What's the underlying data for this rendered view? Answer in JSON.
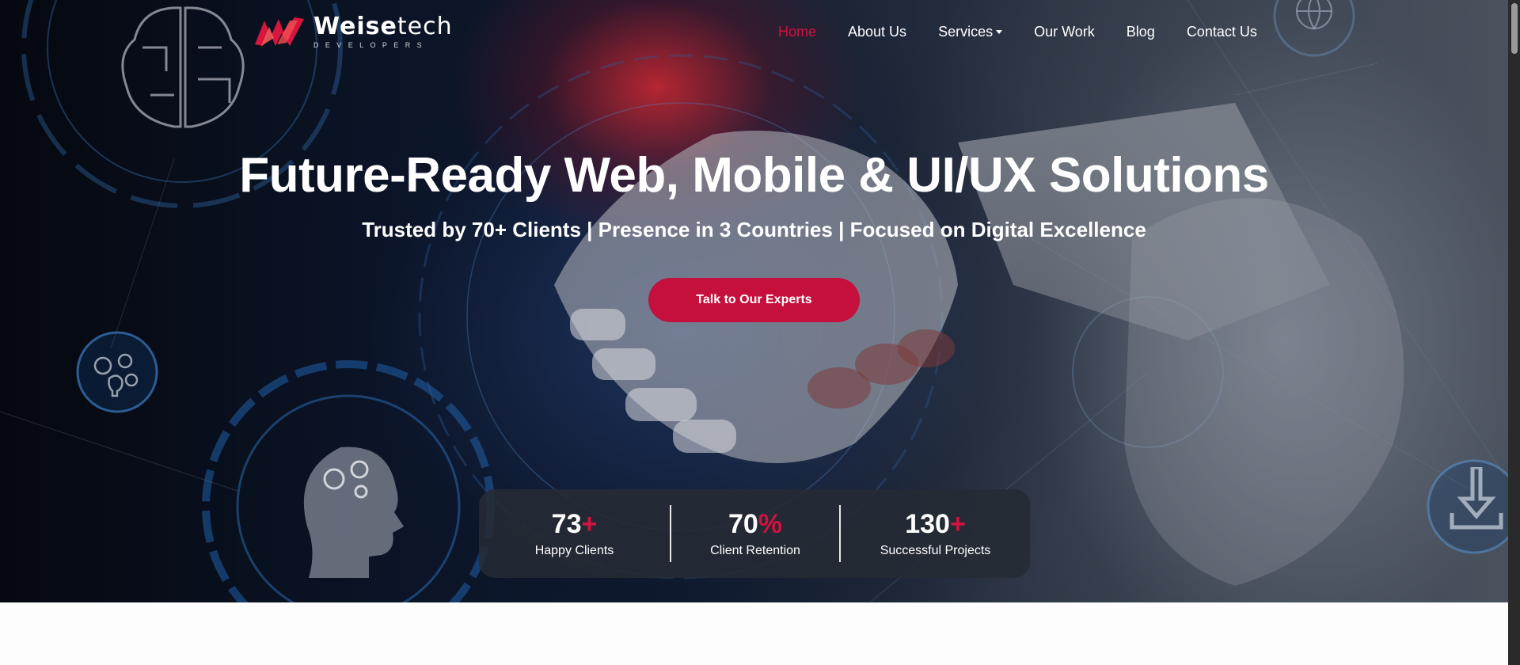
{
  "brand": {
    "name_bold": "Weise",
    "name_light": "tech",
    "tagline": "DEVELOPERS",
    "accent": "#c5103d"
  },
  "nav": {
    "items": [
      {
        "label": "Home",
        "active": true
      },
      {
        "label": "About Us"
      },
      {
        "label": "Services",
        "dropdown": true
      },
      {
        "label": "Our Work"
      },
      {
        "label": "Blog"
      },
      {
        "label": "Contact Us"
      }
    ]
  },
  "hero": {
    "headline": "Future-Ready Web, Mobile & UI/UX Solutions",
    "subline": "Trusted by 70+ Clients | Presence in 3 Countries | Focused on Digital Excellence",
    "cta_label": "Talk to Our Experts"
  },
  "stats": [
    {
      "value": "73",
      "suffix": "+",
      "label": "Happy Clients"
    },
    {
      "value": "70",
      "suffix": "%",
      "label": "Client Retention"
    },
    {
      "value": "130",
      "suffix": "+",
      "label": "Successful Projects"
    }
  ],
  "icons": [
    "brain-circuit-icon",
    "gears-bulb-icon",
    "head-gears-icon",
    "download-icon",
    "globe-icon"
  ]
}
